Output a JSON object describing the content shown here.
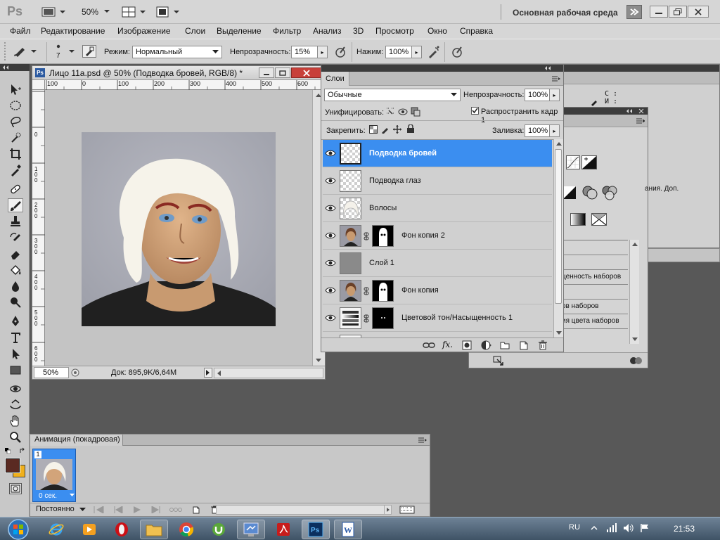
{
  "app": {
    "logo": "Ps",
    "zoom": "50%",
    "workspace_label": "Основная рабочая среда"
  },
  "menu": [
    "Файл",
    "Редактирование",
    "Изображение",
    "Слои",
    "Выделение",
    "Фильтр",
    "Анализ",
    "3D",
    "Просмотр",
    "Окно",
    "Справка"
  ],
  "options": {
    "brush_size": "7",
    "mode_label": "Режим:",
    "mode_value": "Нормальный",
    "opacity_label": "Непрозрачность:",
    "opacity_value": "15%",
    "flow_label": "Нажим:",
    "flow_value": "100%"
  },
  "document": {
    "badge": "Ps",
    "title": "Лицо 11а.psd @ 50% (Подводка бровей, RGB/8) *",
    "ruler_h": [
      "100",
      "0",
      "100",
      "200",
      "300",
      "400",
      "500",
      "600"
    ],
    "ruler_v": [
      "0",
      "1",
      "0",
      "0",
      "2",
      "0",
      "0",
      "3",
      "0",
      "0",
      "4",
      "0",
      "0",
      "5",
      "0",
      "0",
      "6",
      "0",
      "0"
    ],
    "zoom": "50%",
    "doc_info": "Док: 895,9K/6,64M"
  },
  "layers_panel": {
    "tab": "Слои",
    "blend_mode": "Обычные",
    "opacity_label": "Непрозрачность:",
    "opacity_value": "100%",
    "unify_label": "Унифицировать:",
    "propagate_label": "Распространить кадр 1",
    "propagate_checked": true,
    "lock_label": "Закрепить:",
    "fill_label": "Заливка:",
    "fill_value": "100%",
    "layers": [
      {
        "name": "Подводка бровей",
        "thumb": "transparent",
        "mask": false,
        "selected": true
      },
      {
        "name": "Подводка глаз",
        "thumb": "transparent",
        "mask": false,
        "selected": false
      },
      {
        "name": "Волосы",
        "thumb": "hair",
        "mask": false,
        "selected": false
      },
      {
        "name": "Фон копия 2",
        "thumb": "photo",
        "mask": true,
        "selected": false
      },
      {
        "name": "Слой 1",
        "thumb": "gray",
        "mask": false,
        "selected": false
      },
      {
        "name": "Фон копия",
        "thumb": "photo",
        "mask": true,
        "selected": false
      },
      {
        "name": "Цветовой тон/Насыщенность 1",
        "thumb": "adjustment",
        "mask": true,
        "selected": false
      }
    ]
  },
  "back_panel": {
    "channel_c": "C :",
    "channel_i": "И :",
    "list_items": [
      "",
      "",
      "ценность наборов",
      "",
      "ов наборов",
      "ия цвета наборов"
    ],
    "text_fragment": "ания. Доп."
  },
  "animation": {
    "tab": "Анимация (покадровая)",
    "frame_number": "1",
    "frame_delay": "0 сек.",
    "loop": "Постоянно"
  },
  "taskbar": {
    "lang": "RU",
    "time": "21:53"
  },
  "colors": {
    "foreground": "#5a2a22",
    "background": "#f0b01c",
    "selection": "#3b8ef0"
  }
}
